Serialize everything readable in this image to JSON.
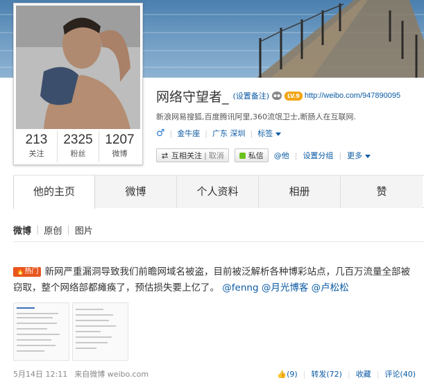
{
  "profile": {
    "name": "网络守望者_",
    "set_note": "(设置备注)",
    "level": "LV.9",
    "url": "http://weibo.com/947890095",
    "bio": "新浪网易搜狐,百度腾讯阿里,360流氓卫士,断肠人在互联网.",
    "gender_symbol": "♂",
    "zodiac": "金牛座",
    "location": "广东 深圳",
    "tags_label": "标签",
    "stats": [
      {
        "value": "213",
        "label": "关注"
      },
      {
        "value": "2325",
        "label": "粉丝"
      },
      {
        "value": "1207",
        "label": "微博"
      }
    ]
  },
  "actions": {
    "mutual_follow": "互相关注",
    "cancel": "取消",
    "message": "私信",
    "mention": "@他",
    "set_group": "设置分组",
    "more": "更多"
  },
  "tabs": [
    "他的主页",
    "微博",
    "个人资料",
    "相册",
    "赞"
  ],
  "filters": [
    "微博",
    "原创",
    "图片"
  ],
  "post": {
    "hot_badge": "热门",
    "text": "新网严重漏洞导致我们前瞻网域名被盗，目前被泛解析各种博彩站点，几百万流量全部被窃取，整个网络部都瘫痪了，预估损失要上亿了。",
    "mentions": [
      "@fenng",
      "@月光博客",
      "@卢松松"
    ],
    "date": "5月14日 12:11",
    "source_prefix": "来自",
    "source": "微博 weibo.com",
    "like": "(9)",
    "repost": "转发(72)",
    "favorite": "收藏",
    "comment": "评论(40)"
  },
  "colors": {
    "link": "#0a5aa4",
    "hot": "#e8561f",
    "level": "#f2a516"
  }
}
